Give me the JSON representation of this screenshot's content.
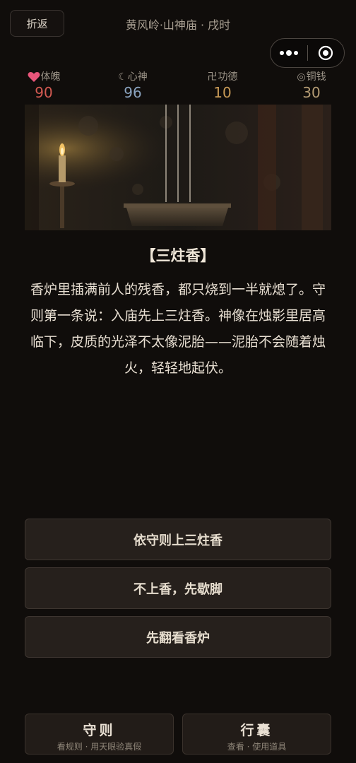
{
  "header": {
    "back_label": "折返",
    "location": "黄风岭·山神庙 · 戌时"
  },
  "stats": [
    {
      "icon": "heart-icon",
      "label": "体魄",
      "value": "90",
      "color": "#d45a52"
    },
    {
      "icon": "moon-icon",
      "label": "心神",
      "value": "96",
      "color": "#8aa3bf"
    },
    {
      "icon": "swastika-icon",
      "label": "功德",
      "value": "10",
      "color": "#c99b57"
    },
    {
      "icon": "coin-icon",
      "label": "铜钱",
      "value": "30",
      "color": "#b59c74"
    }
  ],
  "scene": {
    "title": "【三炷香】",
    "text": "香炉里插满前人的残香，都只烧到一半就熄了。守则第一条说：入庙先上三炷香。神像在烛影里居高临下，皮质的光泽不太像泥胎——泥胎不会随着烛火，轻轻地起伏。"
  },
  "choices": [
    {
      "label": "依守则上三炷香"
    },
    {
      "label": "不上香，先歇脚"
    },
    {
      "label": "先翻看香炉"
    }
  ],
  "bottom": [
    {
      "title": "守则",
      "subtitle": "看规则 · 用天眼验真假"
    },
    {
      "title": "行囊",
      "subtitle": "查看 · 使用道具"
    }
  ]
}
